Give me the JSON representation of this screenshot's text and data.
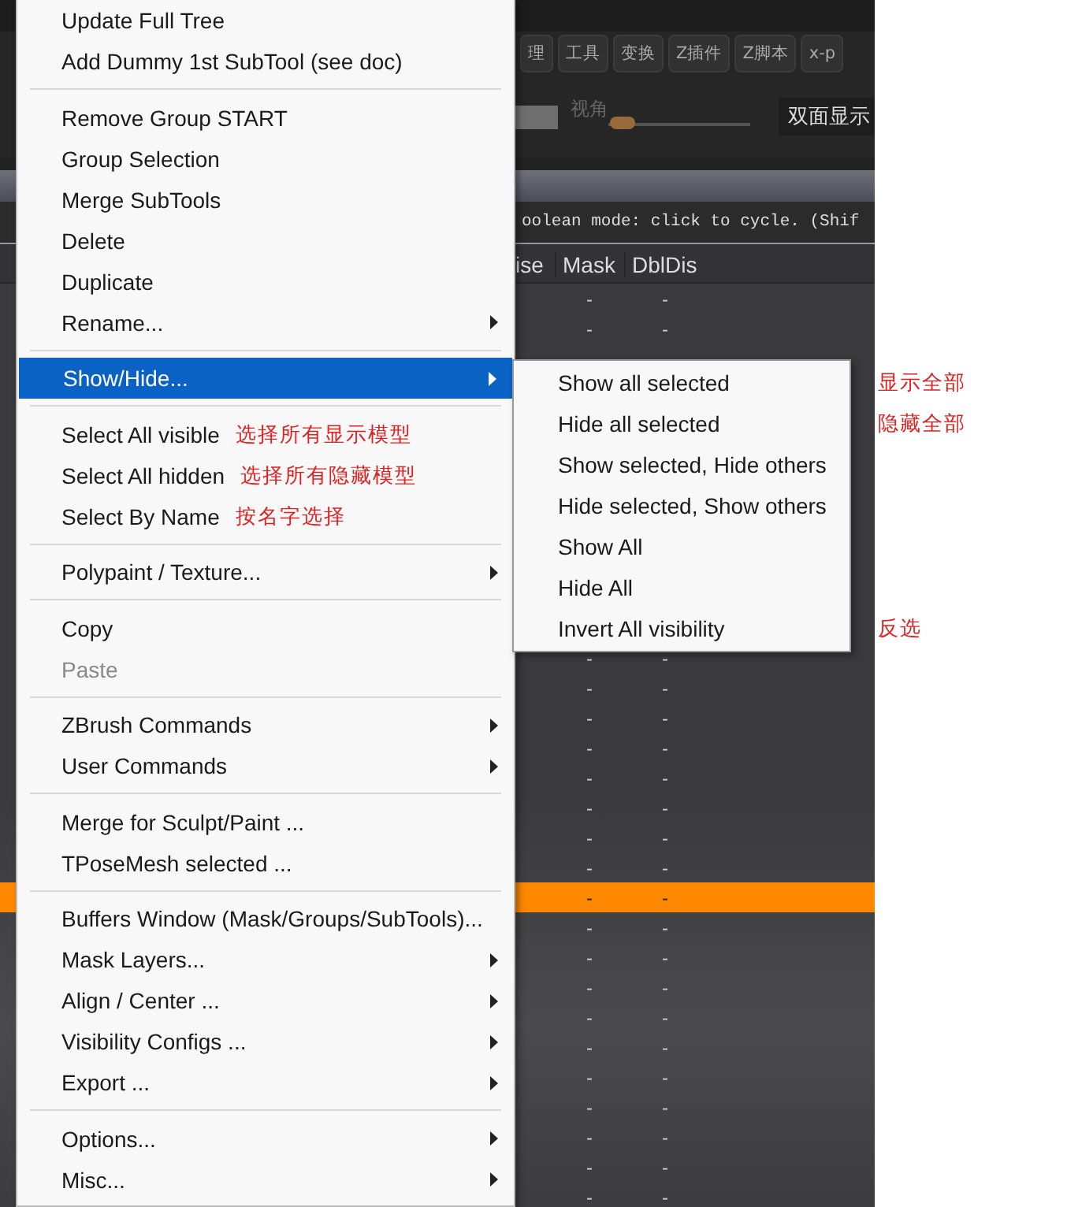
{
  "app": {
    "tabs": [
      {
        "label": "理",
        "selected": false
      },
      {
        "label": "工具",
        "selected": false
      },
      {
        "label": "变换",
        "selected": false
      },
      {
        "label": "Z插件",
        "selected": false
      },
      {
        "label": "Z脚本",
        "selected": false
      },
      {
        "label": "x-p",
        "selected": false
      }
    ],
    "view_angle": {
      "label": "视角",
      "level": 0.1
    },
    "display_mode": {
      "value": "双面显示"
    },
    "hint": "oolean mode: click to cycle. (Shif",
    "table": {
      "columns": [
        "ise",
        "Mask",
        "DblDis"
      ],
      "rows_top": [
        {
          "mask": "-",
          "dbldis": "-",
          "selected": false
        },
        {
          "mask": "-",
          "dbldis": "-",
          "selected": false
        }
      ],
      "rows_bottom": [
        {
          "mask": "-",
          "dbldis": "-",
          "selected": false
        },
        {
          "mask": "-",
          "dbldis": "-",
          "selected": false
        },
        {
          "mask": "-",
          "dbldis": "-",
          "selected": false
        },
        {
          "mask": "-",
          "dbldis": "-",
          "selected": false
        },
        {
          "mask": "-",
          "dbldis": "-",
          "selected": false
        },
        {
          "mask": "-",
          "dbldis": "-",
          "selected": false
        },
        {
          "mask": "-",
          "dbldis": "-",
          "selected": false
        },
        {
          "mask": "-",
          "dbldis": "-",
          "selected": false
        },
        {
          "mask": "-",
          "dbldis": "-",
          "selected": true
        },
        {
          "mask": "-",
          "dbldis": "-",
          "selected": false
        },
        {
          "mask": "-",
          "dbldis": "-",
          "selected": false
        },
        {
          "mask": "-",
          "dbldis": "-",
          "selected": false
        },
        {
          "mask": "-",
          "dbldis": "-",
          "selected": false
        },
        {
          "mask": "-",
          "dbldis": "-",
          "selected": false
        },
        {
          "mask": "-",
          "dbldis": "-",
          "selected": false
        },
        {
          "mask": "-",
          "dbldis": "-",
          "selected": false
        },
        {
          "mask": "-",
          "dbldis": "-",
          "selected": false
        },
        {
          "mask": "-",
          "dbldis": "-",
          "selected": false
        },
        {
          "mask": "-",
          "dbldis": "-",
          "selected": false
        }
      ]
    }
  },
  "context_menu": {
    "items": [
      {
        "kind": "item",
        "label": "Update Full Tree",
        "submenu": false,
        "selected": false,
        "disabled": false
      },
      {
        "kind": "item",
        "label": "Add Dummy 1st SubTool (see doc)",
        "submenu": false,
        "selected": false,
        "disabled": false
      },
      {
        "kind": "separator"
      },
      {
        "kind": "item",
        "label": "Remove Group START",
        "submenu": false,
        "selected": false,
        "disabled": false
      },
      {
        "kind": "item",
        "label": "Group Selection",
        "submenu": false,
        "selected": false,
        "disabled": false
      },
      {
        "kind": "item",
        "label": "Merge SubTools",
        "submenu": false,
        "selected": false,
        "disabled": false
      },
      {
        "kind": "item",
        "label": "Delete",
        "submenu": false,
        "selected": false,
        "disabled": false
      },
      {
        "kind": "item",
        "label": "Duplicate",
        "submenu": false,
        "selected": false,
        "disabled": false
      },
      {
        "kind": "item",
        "label": "Rename...",
        "submenu": true,
        "selected": false,
        "disabled": false
      },
      {
        "kind": "separator"
      },
      {
        "kind": "item",
        "label": "Show/Hide...",
        "submenu": true,
        "selected": true,
        "disabled": false
      },
      {
        "kind": "separator"
      },
      {
        "kind": "item",
        "label": "Select All visible",
        "note": "选择所有显示模型",
        "submenu": false,
        "selected": false,
        "disabled": false
      },
      {
        "kind": "item",
        "label": "Select All hidden",
        "note": "选择所有隐藏模型",
        "submenu": false,
        "selected": false,
        "disabled": false
      },
      {
        "kind": "item",
        "label": "Select By Name",
        "note": "按名字选择",
        "submenu": false,
        "selected": false,
        "disabled": false
      },
      {
        "kind": "separator"
      },
      {
        "kind": "item",
        "label": "Polypaint / Texture...",
        "submenu": true,
        "selected": false,
        "disabled": false
      },
      {
        "kind": "separator"
      },
      {
        "kind": "item",
        "label": "Copy",
        "submenu": false,
        "selected": false,
        "disabled": false
      },
      {
        "kind": "item",
        "label": "Paste",
        "submenu": false,
        "selected": false,
        "disabled": true
      },
      {
        "kind": "separator"
      },
      {
        "kind": "item",
        "label": "ZBrush Commands",
        "submenu": true,
        "selected": false,
        "disabled": false
      },
      {
        "kind": "item",
        "label": "User Commands",
        "submenu": true,
        "selected": false,
        "disabled": false
      },
      {
        "kind": "separator"
      },
      {
        "kind": "item",
        "label": "Merge for Sculpt/Paint ...",
        "submenu": false,
        "selected": false,
        "disabled": false
      },
      {
        "kind": "item",
        "label": "TPoseMesh selected ...",
        "submenu": false,
        "selected": false,
        "disabled": false
      },
      {
        "kind": "separator"
      },
      {
        "kind": "item",
        "label": "Buffers Window (Mask/Groups/SubTools)...",
        "submenu": false,
        "selected": false,
        "disabled": false
      },
      {
        "kind": "item",
        "label": "Mask Layers...",
        "submenu": true,
        "selected": false,
        "disabled": false
      },
      {
        "kind": "item",
        "label": "Align / Center ...",
        "submenu": true,
        "selected": false,
        "disabled": false
      },
      {
        "kind": "item",
        "label": "Visibility Configs ...",
        "submenu": true,
        "selected": false,
        "disabled": false
      },
      {
        "kind": "item",
        "label": "Export ...",
        "submenu": true,
        "selected": false,
        "disabled": false
      },
      {
        "kind": "separator"
      },
      {
        "kind": "item",
        "label": "Options...",
        "submenu": true,
        "selected": false,
        "disabled": false
      },
      {
        "kind": "item",
        "label": "Misc...",
        "submenu": true,
        "selected": false,
        "disabled": false
      }
    ]
  },
  "submenu": {
    "items": [
      {
        "label": "Show all selected",
        "note": "显示全部"
      },
      {
        "label": "Hide all selected",
        "note": "隐藏全部"
      },
      {
        "label": "Show selected, Hide others"
      },
      {
        "label": "Hide selected, Show others"
      },
      {
        "label": "Show All"
      },
      {
        "label": "Hide All"
      },
      {
        "label": "Invert All visibility",
        "note": "反选"
      }
    ]
  }
}
